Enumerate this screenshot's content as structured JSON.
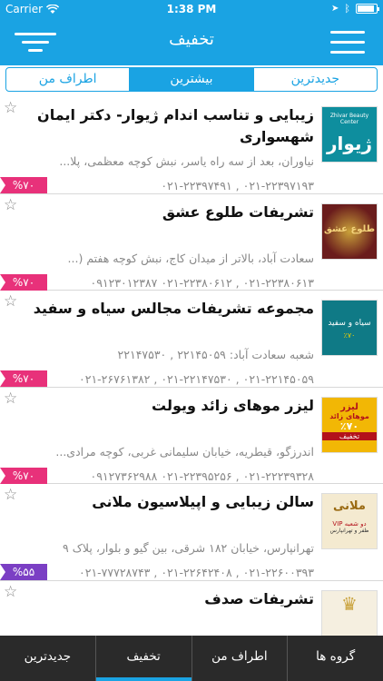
{
  "status": {
    "carrier": "Carrier",
    "time": "1:38 PM",
    "battery_level": 0.9
  },
  "nav": {
    "title": "تخفیف"
  },
  "segments": [
    {
      "label": "جدیدترین",
      "active": false
    },
    {
      "label": "بیشترین",
      "active": true
    },
    {
      "label": "اطراف من",
      "active": false
    }
  ],
  "items": [
    {
      "title": "زیبایی و تناسب اندام ژیوار- دکتر ایمان شهسواری",
      "address": "نیاوران، بعد از سه راه یاسر، نبش کوچه معظمی، پلا...",
      "phones": "۰۲۱-۲۲۳۹۷۱۹۳ , ۰۲۱-۲۲۳۹۷۴۹۱",
      "discount": "%۷۰",
      "badge_color": "#e8317a",
      "thumb": "zhivar",
      "thumb_bg": "#0e8e9e",
      "thumb_text": "ژیوار"
    },
    {
      "title": "تشریفات طلوع عشق",
      "address": "سعادت آباد، بالاتر از میدان کاج، نبش کوچه هفتم (...",
      "phones": "۰۲۱-۲۲۳۸۰۶۱۳ , ۰۲۱-۲۲۳۸۰۶۱۲ ۰۹۱۲۳۰۱۲۳۸۷",
      "discount": "%۷۰",
      "badge_color": "#e8317a",
      "thumb": "tolou",
      "thumb_bg": "#6a1c1c",
      "thumb_text": ""
    },
    {
      "title": "مجموعه تشریفات مجالس سیاه و سفید",
      "address": "شعبه سعادت آباد: ۲۲۱۴۵۰۵۹ , ۲۲۱۴۷۵۳۰",
      "phones": "۰۲۱-۲۲۱۴۵۰۵۹ , ۰۲۱-۲۲۱۴۷۵۳۰ , ۰۲۱-۲۶۷۶۱۳۸۲",
      "discount": "%۷۰",
      "badge_color": "#e8317a",
      "thumb": "siahsefid",
      "thumb_bg": "#0f7a86",
      "thumb_text": ""
    },
    {
      "title": "لیزر موهای زائد ویولت",
      "address": "اندرزگو، قیطریه، خیابان سلیمانی غربی، کوچه مرادی...",
      "phones": "۰۲۱-۲۲۲۳۹۳۲۸ , ۰۲۱-۲۲۳۹۵۲۵۶ ۰۹۱۲۷۳۶۲۹۸۸",
      "discount": "%۷۰",
      "badge_color": "#e8317a",
      "thumb": "violet",
      "thumb_bg": "#f2b705",
      "thumb_text": "لیزر موهای زائد ۷۰٪ تخفیف"
    },
    {
      "title": "سالن زیبایی و اپیلاسیون ملانی",
      "address": "تهرانپارس، خیابان ۱۸۲ شرقی، بین گیو و بلوار، پلاک ۹",
      "phones": "۰۲۱-۲۲۶۰۰۳۹۳ , ۰۲۱-۲۲۶۴۲۴۰۸ , ۰۲۱-۷۷۷۲۸۷۴۳",
      "discount": "%۵۵",
      "badge_color": "#7b3fc4",
      "thumb": "melani",
      "thumb_bg": "#f4ead0",
      "thumb_text": "VIP دو شعبه ظفر و تهرانپارس"
    },
    {
      "title": "تشریفات صدف",
      "address": "",
      "phones": "",
      "discount": "",
      "badge_color": "#e8317a",
      "thumb": "sadaf",
      "thumb_bg": "#f5efe0",
      "thumb_text": ""
    }
  ],
  "tabs": [
    {
      "label": "گروه ها",
      "active": false
    },
    {
      "label": "اطراف من",
      "active": false
    },
    {
      "label": "تخفیف",
      "active": true
    },
    {
      "label": "جدیدترین",
      "active": false
    }
  ],
  "colors": {
    "primary": "#1aa3e3",
    "badge_pink": "#e8317a",
    "badge_purple": "#7b3fc4",
    "tabbar": "#2a2a2a"
  }
}
